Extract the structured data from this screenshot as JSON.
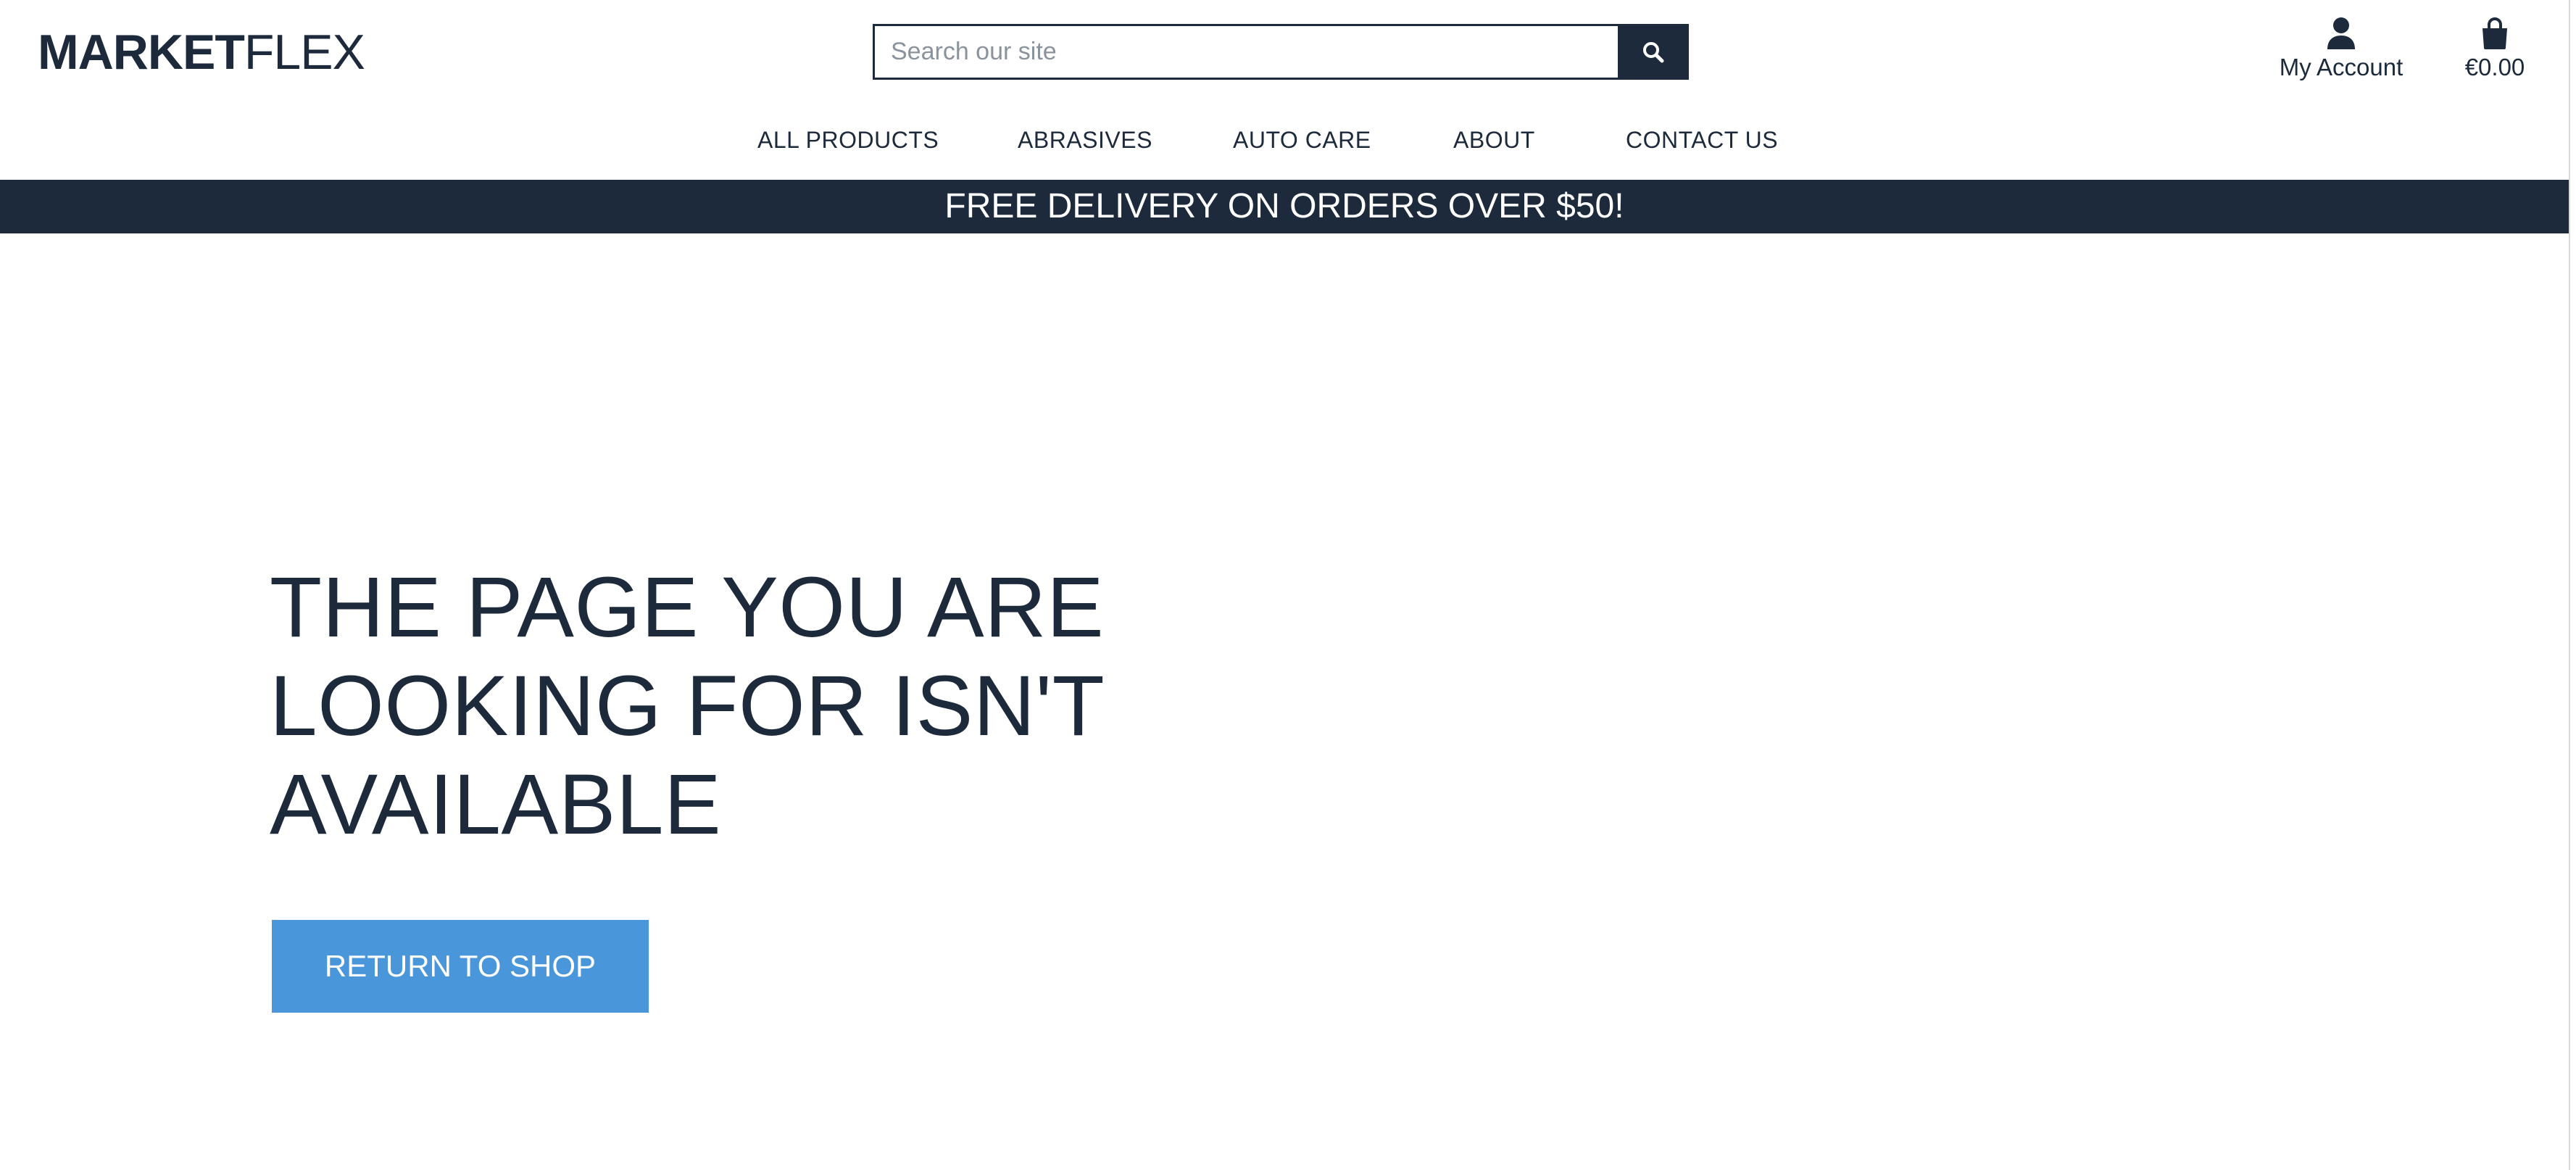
{
  "header": {
    "logo_part1": "MARKET",
    "logo_part2": "FLEX",
    "search_placeholder": "Search our site",
    "search_icon": "search-icon",
    "account_label": "My Account",
    "account_icon": "user-icon",
    "bag_amount": "€0.00",
    "bag_icon": "shopping-bag-icon"
  },
  "nav": {
    "items": [
      {
        "label": "ALL PRODUCTS"
      },
      {
        "label": "ABRASIVES"
      },
      {
        "label": "AUTO CARE"
      },
      {
        "label": "ABOUT"
      },
      {
        "label": "CONTACT US"
      }
    ]
  },
  "banner": {
    "text": "FREE DELIVERY ON ORDERS OVER $50!"
  },
  "main": {
    "headline": "THE PAGE YOU ARE LOOKING FOR ISN'T AVAILABLE",
    "return_button": "RETURN TO SHOP"
  },
  "colors": {
    "primary": "#1c2a3b",
    "accent": "#4a96db",
    "background": "#ffffff"
  }
}
